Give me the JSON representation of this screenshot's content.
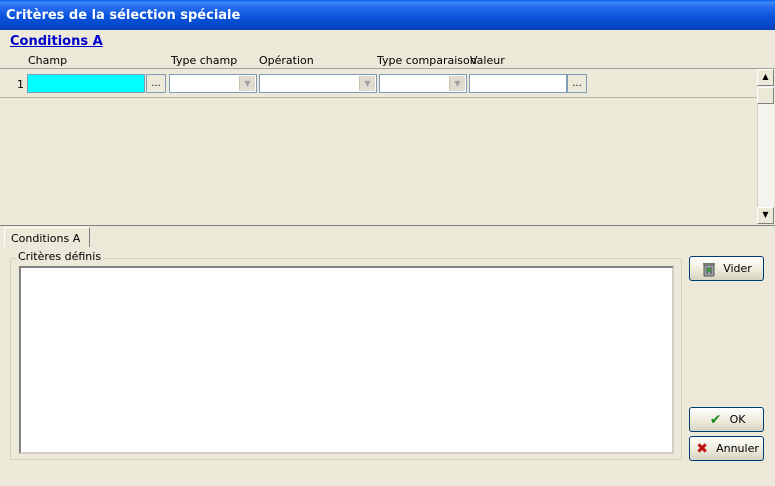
{
  "window": {
    "title": "Critères de la sélection spéciale"
  },
  "conditions": {
    "section_title": "Conditions A",
    "columns": [
      "Champ",
      "Type champ",
      "Opération",
      "Type comparaison",
      "Valeur"
    ],
    "rows": [
      {
        "number": "1",
        "champ": "",
        "type_champ": "",
        "operation": "",
        "type_comparaison": "",
        "valeur": ""
      }
    ],
    "dots_label": "..."
  },
  "tabs": [
    {
      "label": "Conditions A",
      "active": true
    }
  ],
  "criteria": {
    "legend": "Critères définis",
    "text": ""
  },
  "buttons": {
    "vider": {
      "label": "Vider",
      "icon": "trash-icon"
    },
    "ok": {
      "label": "OK",
      "icon": "check-icon",
      "icon_color": "#1a8a1a"
    },
    "annuler": {
      "label": "Annuler",
      "icon": "x-icon",
      "icon_color": "#c01010"
    }
  },
  "colors": {
    "accent": "#0a54dc",
    "champ_highlight": "#00ffff",
    "link": "#0000cc"
  }
}
